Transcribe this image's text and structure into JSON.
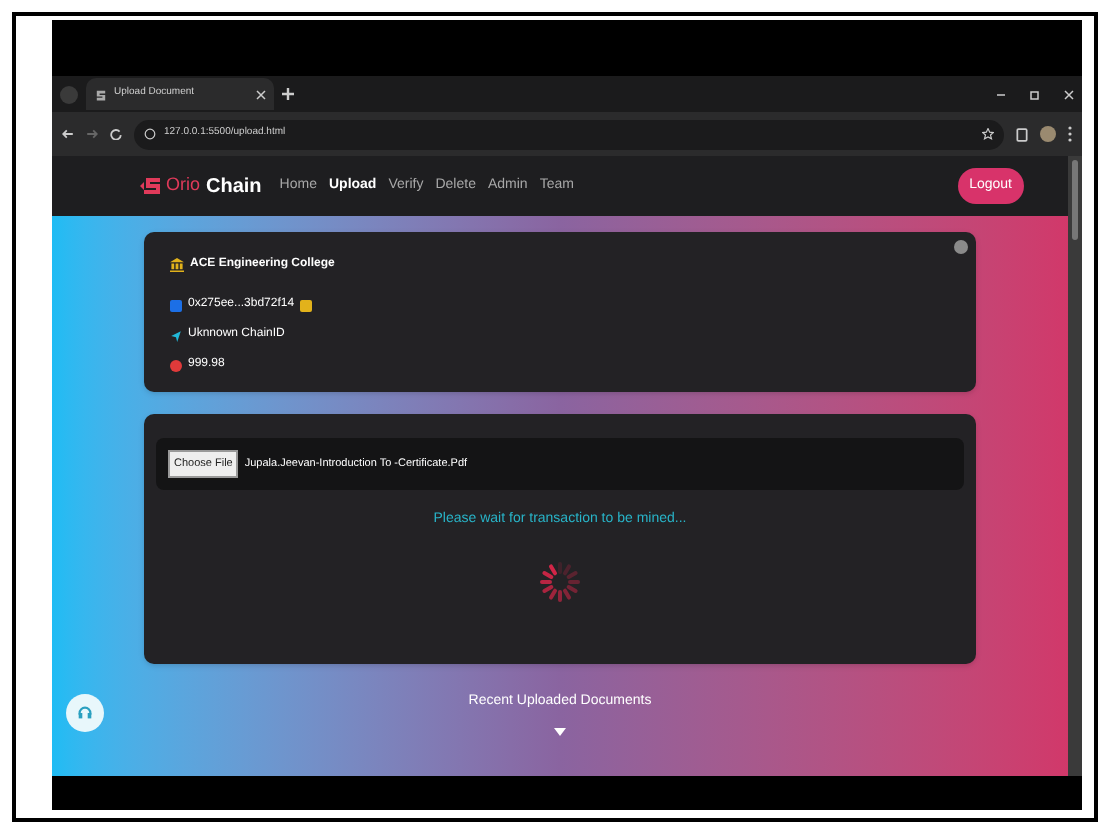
{
  "browser": {
    "tab_title": "Upload Document",
    "url": "127.0.0.1:5500/upload.html"
  },
  "navbar": {
    "brand_prefix": "Orio",
    "brand_suffix": "Chain",
    "links": [
      {
        "label": "Home",
        "selected": false
      },
      {
        "label": "Upload",
        "selected": true
      },
      {
        "label": "Verify",
        "selected": false
      },
      {
        "label": "Delete",
        "selected": false
      },
      {
        "label": "Admin",
        "selected": false
      },
      {
        "label": "Team",
        "selected": false
      }
    ],
    "logout": "Logout"
  },
  "account": {
    "institution": "ACE Engineering College",
    "address": "0x275ee...3bd72f14",
    "chain": "Uknnown ChainID",
    "balance": "999.98"
  },
  "upload": {
    "button": "Choose File",
    "file_name": "Jupala.Jeevan-Introduction To -Certificate.Pdf",
    "status": "Please wait for transaction to be mined..."
  },
  "recent": {
    "title": "Recent Uploaded Documents"
  }
}
